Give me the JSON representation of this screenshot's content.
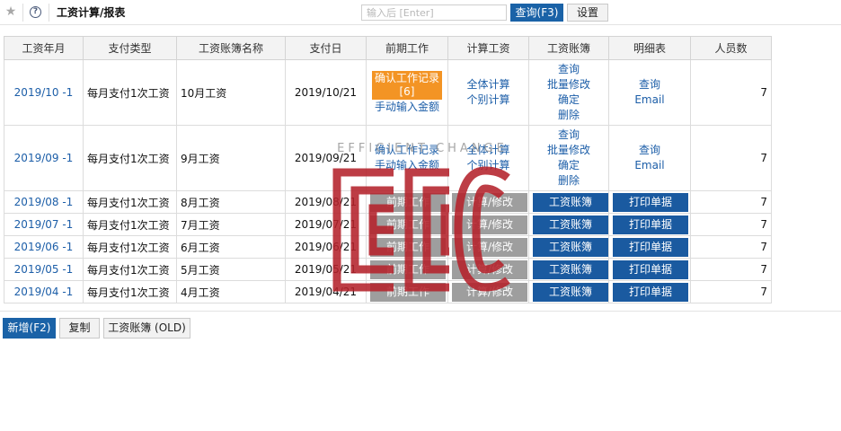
{
  "header": {
    "title": "工资计算/报表",
    "search_placeholder": "输入后 [Enter]",
    "search_value": "",
    "search_label": "查询(F3)",
    "settings_label": "设置"
  },
  "table": {
    "columns": [
      "工资年月",
      "支付类型",
      "工资账簿名称",
      "支付日",
      "前期工作",
      "计算工资",
      "工资账簿",
      "明细表",
      "人员数"
    ],
    "rows": [
      {
        "ym": "2019/10 -1",
        "type": "每月支付1次工资",
        "name": "10月工资",
        "payday": "2019/10/21",
        "pre": {
          "confirm": "确认工作记录",
          "count": "[6]",
          "manual": "手动输入金额"
        },
        "calc": [
          "全体计算",
          "个别计算"
        ],
        "ledger": [
          "查询",
          "批量修改",
          "确定",
          "删除"
        ],
        "detail": [
          "查询",
          "Email"
        ],
        "count": "7"
      },
      {
        "ym": "2019/09 -1",
        "type": "每月支付1次工资",
        "name": "9月工资",
        "payday": "2019/09/21",
        "pre": {
          "confirm": "确认工作记录",
          "manual": "手动输入金额"
        },
        "calc": [
          "全体计算",
          "个别计算"
        ],
        "ledger": [
          "查询",
          "批量修改",
          "确定",
          "删除"
        ],
        "detail": [
          "查询",
          "Email"
        ],
        "count": "7"
      },
      {
        "ym": "2019/08 -1",
        "type": "每月支付1次工资",
        "name": "8月工资",
        "payday": "2019/08/21",
        "pre": "前期工作",
        "calc": "计算/修改",
        "ledger": "工资账簿",
        "detail": "打印单据",
        "count": "7"
      },
      {
        "ym": "2019/07 -1",
        "type": "每月支付1次工资",
        "name": "7月工资",
        "payday": "2019/07/21",
        "pre": "前期工作",
        "calc": "计算/修改",
        "ledger": "工资账簿",
        "detail": "打印单据",
        "count": "7"
      },
      {
        "ym": "2019/06 -1",
        "type": "每月支付1次工资",
        "name": "6月工资",
        "payday": "2019/06/21",
        "pre": "前期工作",
        "calc": "计算/修改",
        "ledger": "工资账簿",
        "detail": "打印单据",
        "count": "7"
      },
      {
        "ym": "2019/05 -1",
        "type": "每月支付1次工资",
        "name": "5月工资",
        "payday": "2019/05/21",
        "pre": "前期工作",
        "calc": "计算/修改",
        "ledger": "工资账簿",
        "detail": "打印单据",
        "count": "7"
      },
      {
        "ym": "2019/04 -1",
        "type": "每月支付1次工资",
        "name": "4月工资",
        "payday": "2019/04/21",
        "pre": "前期工作",
        "calc": "计算/修改",
        "ledger": "工资账簿",
        "detail": "打印单据",
        "count": "7"
      }
    ]
  },
  "footer": {
    "new_label": "新增(F2)",
    "copy_label": "复制",
    "old_label": "工资账簿 (OLD)"
  },
  "watermark": {
    "text": "EFFICIENT CHANGE"
  },
  "icons": {
    "favorite": "star-icon",
    "help": "help-icon"
  },
  "colors": {
    "primary": "#1a62a7",
    "link": "#1c5ea8",
    "highlight": "#f39424",
    "disabled": "#9e9e9e",
    "watermark": "#b5232c"
  }
}
